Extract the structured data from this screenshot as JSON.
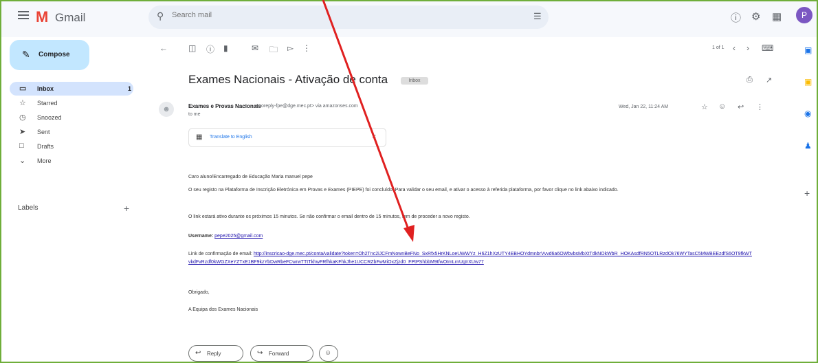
{
  "app": {
    "name": "Gmail",
    "avatar_initial": "P"
  },
  "search": {
    "placeholder": "Search mail"
  },
  "compose_label": "Compose",
  "sidebar": {
    "items": [
      {
        "label": "Inbox",
        "count": "1",
        "icon": "inbox-icon"
      },
      {
        "label": "Starred",
        "icon": "star-icon"
      },
      {
        "label": "Snoozed",
        "icon": "clock-icon"
      },
      {
        "label": "Sent",
        "icon": "send-icon"
      },
      {
        "label": "Drafts",
        "icon": "draft-icon"
      },
      {
        "label": "More",
        "icon": "chevron-down-icon"
      }
    ],
    "labels_heading": "Labels"
  },
  "pager": "1 of 1",
  "message": {
    "subject": "Exames Nacionais - Ativação de conta",
    "badge": "Inbox",
    "sender_name": "Exames e Provas Nacionais",
    "sender_email": "<noreply-fpe@dge.mec.pt> via amazonses.com",
    "to": "to me",
    "date": "Wed, Jan 22, 11:24 AM",
    "translate_label": "Translate to English",
    "greeting": "Caro aluno/Encarregado de Educação Maria manuel pepe",
    "para1": "O seu registo na Plataforma de Inscrição Eletrónica em Provas e Exames (PIEPE) foi concluído. Para validar o seu email, e ativar o acesso à referida plataforma, por favor clique no link abaixo indicado.",
    "para2": "O link estará ativo durante os próximos 15 minutos. Se não confirmar o email dentro de 15 minutos, tem de proceder a novo registo.",
    "username_label": "Username:",
    "username_value": "pepe2025@gmail.com",
    "link_label": "Link de confirmação de email:",
    "link_value": "http://inscricao-dge.mec.pt/conta/validate?token=Oh2Tnc2iJCFmNownBeFNo_SxRfx5HrKNLoeUWWYz_H6Z1hXzUTY4EBHOYdmnbrVvvd6a6OWbvbsMbXtTdkNOkWbR_HOKAsdfRN5OTLRzdOk76WYTasC5MWBEEzdfS6OT9fkWTvkdFvRzdf0kWGZXeYZTxE1BF9kzYbDwRbeFCwrwTTtTkhwFRfhkaKFhkJhe1UCCRZbFwMiOxZjzd0_FPtPShbbM9tfwOImLrnUgIrXUw77",
    "thanks": "Obrigado,",
    "signature": "A Equipa dos Exames Nacionais"
  },
  "actions": {
    "reply": "Reply",
    "forward": "Forward"
  },
  "colors": {
    "annotation_arrow": "#e02020",
    "frame": "#6fae3a",
    "compose_bg": "#c2e7ff"
  }
}
